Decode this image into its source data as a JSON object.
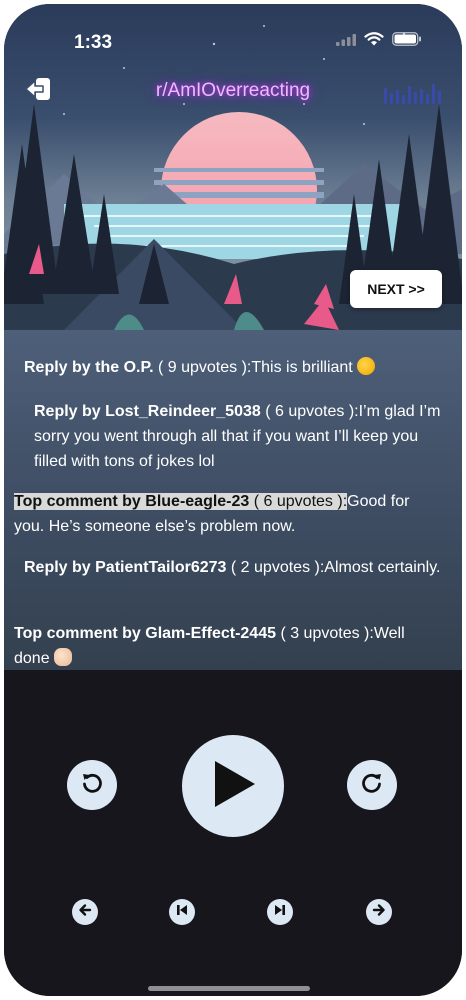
{
  "status_bar": {
    "time": "1:33",
    "icons": [
      "cellular-signal-icon",
      "wifi-icon",
      "battery-icon"
    ]
  },
  "header": {
    "back_icon": "back-arrow-icon",
    "title": "r/AmIOverreacting",
    "audio_icon": "audio-bars-icon",
    "title_color": "#f3b8ff"
  },
  "next_button": {
    "label": "NEXT >>"
  },
  "comments": [
    {
      "prefix": "Reply by the O.P.",
      "upvotes": "( 9 upvotes )",
      "separator": ":",
      "text": "This is brilliant",
      "emoji": "rolling-laughing-emoji"
    },
    {
      "prefix": "Reply by Lost_Reindeer_5038",
      "upvotes": "( 6 upvotes )",
      "separator": ":",
      "text": "I’m glad I’m sorry you went through all that if you want I’ll keep you filled with tons of jokes lol"
    },
    {
      "prefix": "Top comment by Blue-eagle-23",
      "upvotes": "( 6 upvotes )",
      "separator": ":",
      "text": "Good for you. He’s someone else’s problem now.",
      "highlighted": true
    },
    {
      "prefix": "Reply by PatientTailor6273",
      "upvotes": "( 2 upvotes )",
      "separator": ":",
      "text": "Almost certainly."
    },
    {
      "prefix": "Top comment by Glam-Effect-2445",
      "upvotes": "( 3 upvotes )",
      "separator": ":",
      "text": "Well done",
      "emoji": "clapping-hands-emoji"
    }
  ],
  "player": {
    "rewind_icon": "rewind-icon",
    "play_icon": "play-icon",
    "forward_icon": "forward-icon",
    "prev_icon": "arrow-left-icon",
    "skip_back_icon": "skip-back-icon",
    "skip_forward_icon": "skip-forward-icon",
    "next_icon": "arrow-right-icon",
    "button_color": "#dde8f5",
    "background_color": "#17161c"
  }
}
